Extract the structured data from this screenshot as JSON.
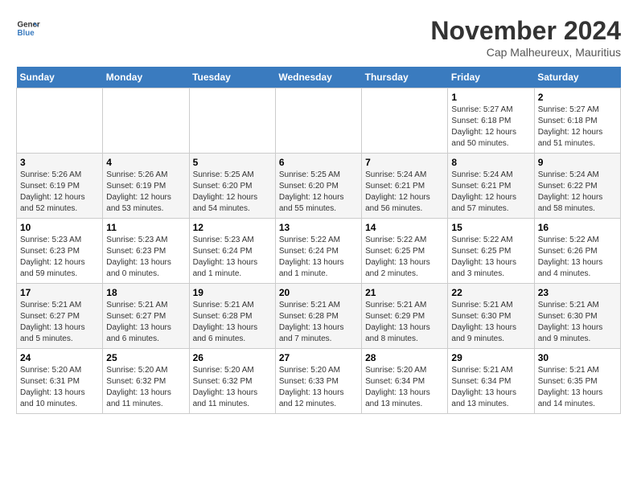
{
  "header": {
    "logo_text_general": "General",
    "logo_text_blue": "Blue",
    "month_year": "November 2024",
    "location": "Cap Malheureux, Mauritius"
  },
  "days_of_week": [
    "Sunday",
    "Monday",
    "Tuesday",
    "Wednesday",
    "Thursday",
    "Friday",
    "Saturday"
  ],
  "weeks": [
    [
      {
        "day": "",
        "info": ""
      },
      {
        "day": "",
        "info": ""
      },
      {
        "day": "",
        "info": ""
      },
      {
        "day": "",
        "info": ""
      },
      {
        "day": "",
        "info": ""
      },
      {
        "day": "1",
        "info": "Sunrise: 5:27 AM\nSunset: 6:18 PM\nDaylight: 12 hours and 50 minutes."
      },
      {
        "day": "2",
        "info": "Sunrise: 5:27 AM\nSunset: 6:18 PM\nDaylight: 12 hours and 51 minutes."
      }
    ],
    [
      {
        "day": "3",
        "info": "Sunrise: 5:26 AM\nSunset: 6:19 PM\nDaylight: 12 hours and 52 minutes."
      },
      {
        "day": "4",
        "info": "Sunrise: 5:26 AM\nSunset: 6:19 PM\nDaylight: 12 hours and 53 minutes."
      },
      {
        "day": "5",
        "info": "Sunrise: 5:25 AM\nSunset: 6:20 PM\nDaylight: 12 hours and 54 minutes."
      },
      {
        "day": "6",
        "info": "Sunrise: 5:25 AM\nSunset: 6:20 PM\nDaylight: 12 hours and 55 minutes."
      },
      {
        "day": "7",
        "info": "Sunrise: 5:24 AM\nSunset: 6:21 PM\nDaylight: 12 hours and 56 minutes."
      },
      {
        "day": "8",
        "info": "Sunrise: 5:24 AM\nSunset: 6:21 PM\nDaylight: 12 hours and 57 minutes."
      },
      {
        "day": "9",
        "info": "Sunrise: 5:24 AM\nSunset: 6:22 PM\nDaylight: 12 hours and 58 minutes."
      }
    ],
    [
      {
        "day": "10",
        "info": "Sunrise: 5:23 AM\nSunset: 6:23 PM\nDaylight: 12 hours and 59 minutes."
      },
      {
        "day": "11",
        "info": "Sunrise: 5:23 AM\nSunset: 6:23 PM\nDaylight: 13 hours and 0 minutes."
      },
      {
        "day": "12",
        "info": "Sunrise: 5:23 AM\nSunset: 6:24 PM\nDaylight: 13 hours and 1 minute."
      },
      {
        "day": "13",
        "info": "Sunrise: 5:22 AM\nSunset: 6:24 PM\nDaylight: 13 hours and 1 minute."
      },
      {
        "day": "14",
        "info": "Sunrise: 5:22 AM\nSunset: 6:25 PM\nDaylight: 13 hours and 2 minutes."
      },
      {
        "day": "15",
        "info": "Sunrise: 5:22 AM\nSunset: 6:25 PM\nDaylight: 13 hours and 3 minutes."
      },
      {
        "day": "16",
        "info": "Sunrise: 5:22 AM\nSunset: 6:26 PM\nDaylight: 13 hours and 4 minutes."
      }
    ],
    [
      {
        "day": "17",
        "info": "Sunrise: 5:21 AM\nSunset: 6:27 PM\nDaylight: 13 hours and 5 minutes."
      },
      {
        "day": "18",
        "info": "Sunrise: 5:21 AM\nSunset: 6:27 PM\nDaylight: 13 hours and 6 minutes."
      },
      {
        "day": "19",
        "info": "Sunrise: 5:21 AM\nSunset: 6:28 PM\nDaylight: 13 hours and 6 minutes."
      },
      {
        "day": "20",
        "info": "Sunrise: 5:21 AM\nSunset: 6:28 PM\nDaylight: 13 hours and 7 minutes."
      },
      {
        "day": "21",
        "info": "Sunrise: 5:21 AM\nSunset: 6:29 PM\nDaylight: 13 hours and 8 minutes."
      },
      {
        "day": "22",
        "info": "Sunrise: 5:21 AM\nSunset: 6:30 PM\nDaylight: 13 hours and 9 minutes."
      },
      {
        "day": "23",
        "info": "Sunrise: 5:21 AM\nSunset: 6:30 PM\nDaylight: 13 hours and 9 minutes."
      }
    ],
    [
      {
        "day": "24",
        "info": "Sunrise: 5:20 AM\nSunset: 6:31 PM\nDaylight: 13 hours and 10 minutes."
      },
      {
        "day": "25",
        "info": "Sunrise: 5:20 AM\nSunset: 6:32 PM\nDaylight: 13 hours and 11 minutes."
      },
      {
        "day": "26",
        "info": "Sunrise: 5:20 AM\nSunset: 6:32 PM\nDaylight: 13 hours and 11 minutes."
      },
      {
        "day": "27",
        "info": "Sunrise: 5:20 AM\nSunset: 6:33 PM\nDaylight: 13 hours and 12 minutes."
      },
      {
        "day": "28",
        "info": "Sunrise: 5:20 AM\nSunset: 6:34 PM\nDaylight: 13 hours and 13 minutes."
      },
      {
        "day": "29",
        "info": "Sunrise: 5:21 AM\nSunset: 6:34 PM\nDaylight: 13 hours and 13 minutes."
      },
      {
        "day": "30",
        "info": "Sunrise: 5:21 AM\nSunset: 6:35 PM\nDaylight: 13 hours and 14 minutes."
      }
    ]
  ]
}
